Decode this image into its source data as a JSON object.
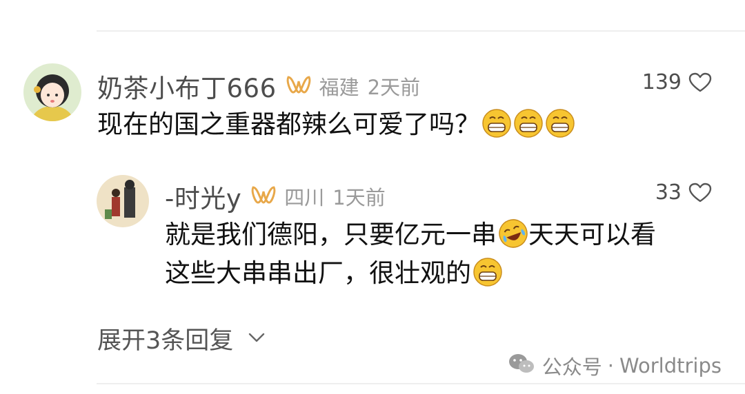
{
  "comments": [
    {
      "username": "奶茶小布丁666",
      "location": "福建",
      "time": "2天前",
      "likes": "139",
      "text": "现在的国之重器都辣么可爱了吗？",
      "emojis": [
        "grin-emoji",
        "grin-emoji",
        "grin-emoji"
      ],
      "reply": {
        "username": "-时光y",
        "location": "四川",
        "time": "1天前",
        "likes": "33",
        "line1": "就是我们德阳，只要亿元一串",
        "line1_emoji": "laugh-cry-emoji",
        "line1_tail": "天天可以看",
        "line2": "这些大串串出厂，很壮观的",
        "line2_emoji": "grin-emoji"
      }
    }
  ],
  "expand_replies": "展开3条回复",
  "watermark": {
    "prefix": "公众号",
    "sep": "·",
    "name": "Worldtrips"
  },
  "colors": {
    "vip": "#e8a84a",
    "emoji_face": "#f7c531",
    "text": "#111111",
    "meta": "#9a9a9a"
  }
}
